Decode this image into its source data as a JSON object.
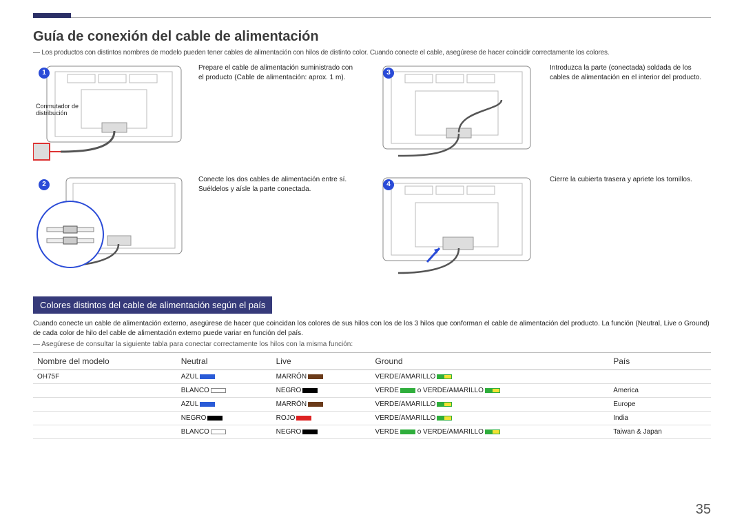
{
  "page_number": "35",
  "section_title": "Guía de conexión del cable de alimentación",
  "lead": "― Los productos con distintos nombres de modelo pueden tener cables de alimentación con hilos de distinto color. Cuando conecte el cable, asegúrese de hacer coincidir correctamente los colores.",
  "steps": [
    {
      "num": "1",
      "text": "Prepare el cable de alimentación suministrado con el producto (Cable de alimentación: aprox. 1 m).",
      "img_label": "Conmutador de distribución"
    },
    {
      "num": "3",
      "text": "Introduzca la parte (conectada) soldada de los cables de alimentación en el interior del producto."
    },
    {
      "num": "2",
      "text": "Conecte los dos cables de alimentación entre sí. Suéldelos y aísle la parte conectada."
    },
    {
      "num": "4",
      "text": "Cierre la cubierta trasera y apriete los tornillos."
    }
  ],
  "sub_title": "Colores distintos del cable de alimentación según el país",
  "sub_lead": "Cuando conecte un cable de alimentación externo, asegúrese de hacer que coincidan los colores de sus hilos con los de los 3 hilos que conforman el cable de alimentación del producto. La función (Neutral, Live o Ground) de cada color de hilo del cable de alimentación externo puede variar en función del país.",
  "footnote": "― Asegúrese de consultar la siguiente tabla para conectar correctamente los hilos con la misma función:",
  "table": {
    "headers": {
      "model": "Nombre del modelo",
      "neutral": "Neutral",
      "live": "Live",
      "ground": "Ground",
      "country": "País"
    },
    "rows": [
      {
        "model": "OH75F",
        "neutral": "AZUL",
        "live": "MARRÓN",
        "ground": "VERDE/AMARILLO",
        "country": ""
      },
      {
        "model": "",
        "neutral": "BLANCO",
        "live": "NEGRO",
        "ground": "VERDE o VERDE/AMARILLO",
        "country": "America"
      },
      {
        "model": "",
        "neutral": "AZUL",
        "live": "MARRÓN",
        "ground": "VERDE/AMARILLO",
        "country": "Europe"
      },
      {
        "model": "",
        "neutral": "NEGRO",
        "live": "ROJO",
        "ground": "VERDE/AMARILLO",
        "country": "India"
      },
      {
        "model": "",
        "neutral": "BLANCO",
        "live": "NEGRO",
        "ground": "VERDE o VERDE/AMARILLO",
        "country": "Taiwan & Japan"
      }
    ]
  }
}
